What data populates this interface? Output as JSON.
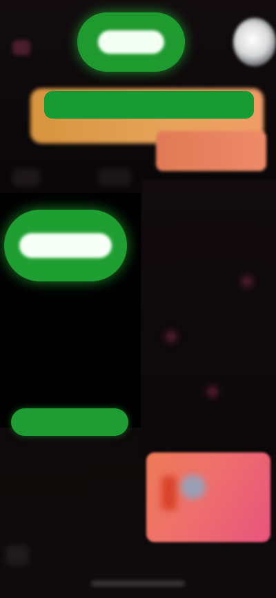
{
  "status_bar": {
    "time": ""
  },
  "header": {
    "primary_action_label": "",
    "profile_avatar": "avatar"
  },
  "banner": {
    "green_label": "",
    "colors": {
      "orange": "#e8a35a",
      "green": "#159a34",
      "coral": "#ee8a69"
    }
  },
  "left_panel": {
    "pill_label": "",
    "bar_label": ""
  },
  "right_panel": {
    "photo_card": "image"
  },
  "theme": {
    "background": "#0b0809",
    "accent_green": "#1f9f31",
    "accent_pink": "#e8547e"
  },
  "icons": {
    "menu": "menu-icon",
    "bottom_left": "bottom-nav-icon"
  }
}
